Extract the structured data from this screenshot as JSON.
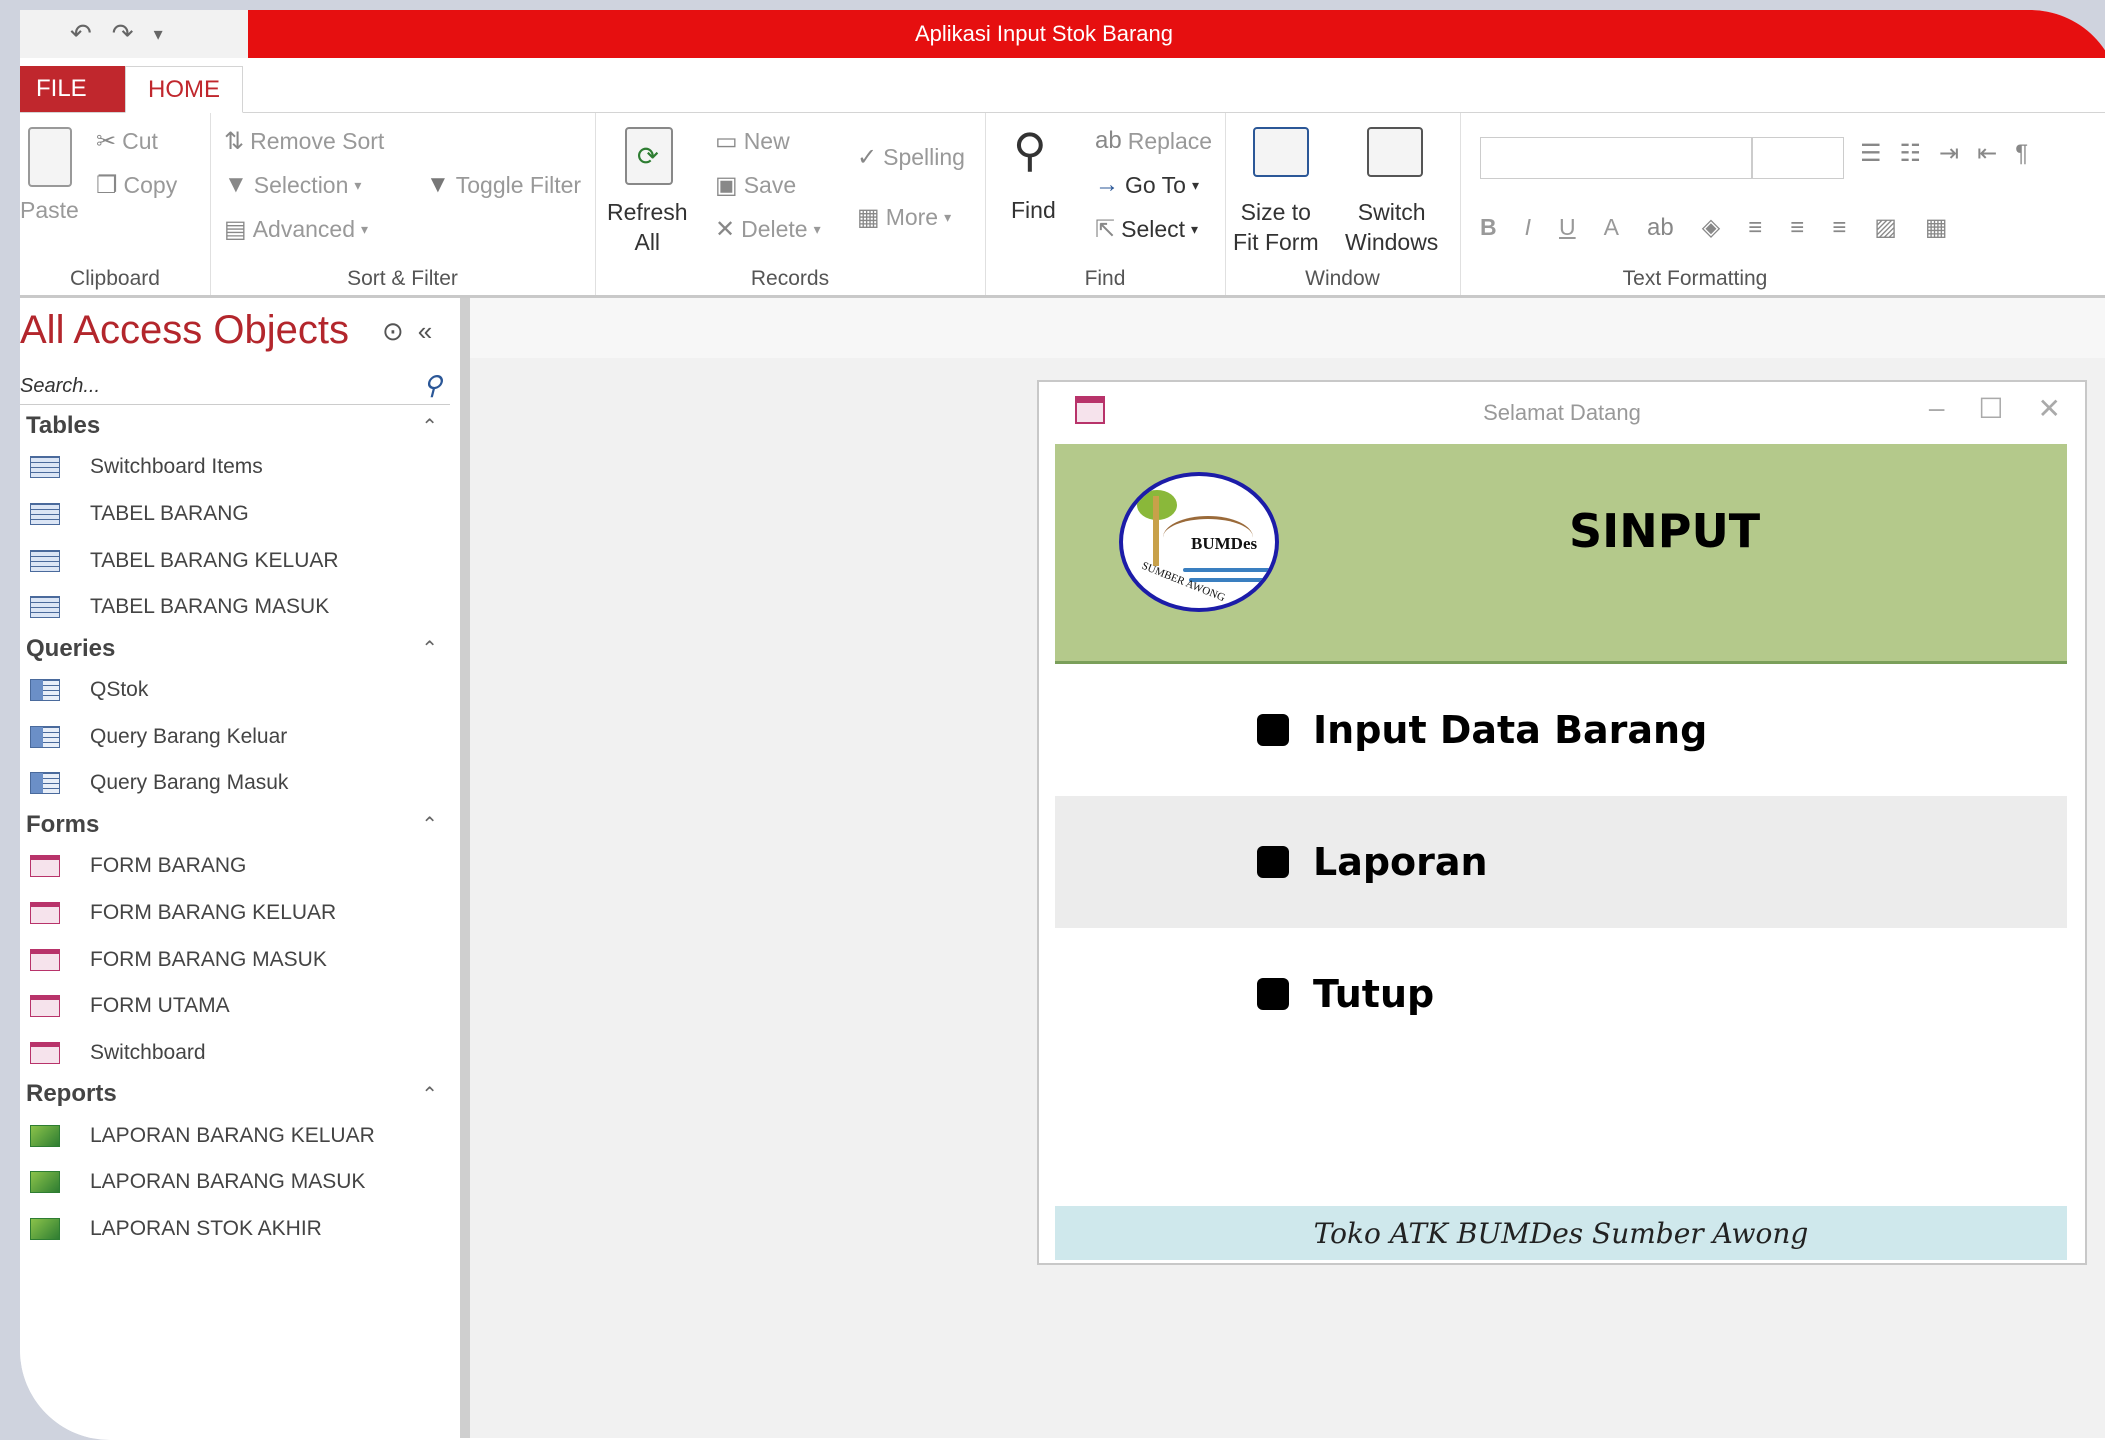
{
  "window": {
    "title": "Aplikasi Input Stok Barang"
  },
  "tabs": {
    "file": "FILE",
    "home": "HOME"
  },
  "ribbon": {
    "clipboard": {
      "label": "Clipboard",
      "paste": "Paste",
      "cut": "Cut",
      "copy": "Copy"
    },
    "sort_filter": {
      "label": "Sort & Filter",
      "remove_sort": "Remove Sort",
      "selection": "Selection",
      "advanced": "Advanced",
      "toggle_filter": "Toggle Filter"
    },
    "records": {
      "label": "Records",
      "refresh": "Refresh",
      "refresh_all": "All",
      "new": "New",
      "save": "Save",
      "delete": "Delete",
      "spelling": "Spelling",
      "more": "More"
    },
    "find": {
      "label": "Find",
      "find": "Find",
      "replace": "Replace",
      "goto": "Go To",
      "select": "Select"
    },
    "window": {
      "label": "Window",
      "size_to": "Size to",
      "fit_form": "Fit Form",
      "switch": "Switch",
      "windows": "Windows"
    },
    "text_formatting": {
      "label": "Text Formatting",
      "bold": "B",
      "italic": "I",
      "underline": "U",
      "font_color": "A"
    }
  },
  "nav": {
    "title": "All Access Objects",
    "search_placeholder": "Search...",
    "categories": [
      {
        "name": "Tables",
        "items": [
          "Switchboard Items",
          "TABEL BARANG",
          "TABEL BARANG KELUAR",
          "TABEL BARANG MASUK"
        ]
      },
      {
        "name": "Queries",
        "items": [
          "QStok",
          "Query Barang Keluar",
          "Query Barang Masuk"
        ]
      },
      {
        "name": "Forms",
        "items": [
          "FORM BARANG",
          "FORM BARANG KELUAR",
          "FORM BARANG MASUK",
          "FORM UTAMA",
          "Switchboard"
        ]
      },
      {
        "name": "Reports",
        "items": [
          "LAPORAN BARANG KELUAR",
          "LAPORAN BARANG MASUK",
          "LAPORAN STOK AKHIR"
        ]
      }
    ]
  },
  "dialog": {
    "title": "Selamat Datang",
    "app_name": "SINPUT",
    "logo_text": "BUMDes",
    "logo_subtext": "SUMBER AWONG",
    "menu": [
      "Input Data Barang",
      "Laporan",
      "Tutup"
    ],
    "footer": "Toko ATK BUMDes Sumber Awong"
  },
  "colors": {
    "title_bar": "#e60f10",
    "accent": "#b3262c",
    "header_green": "#b4c98b",
    "footer_blue": "#cfe8ec"
  }
}
